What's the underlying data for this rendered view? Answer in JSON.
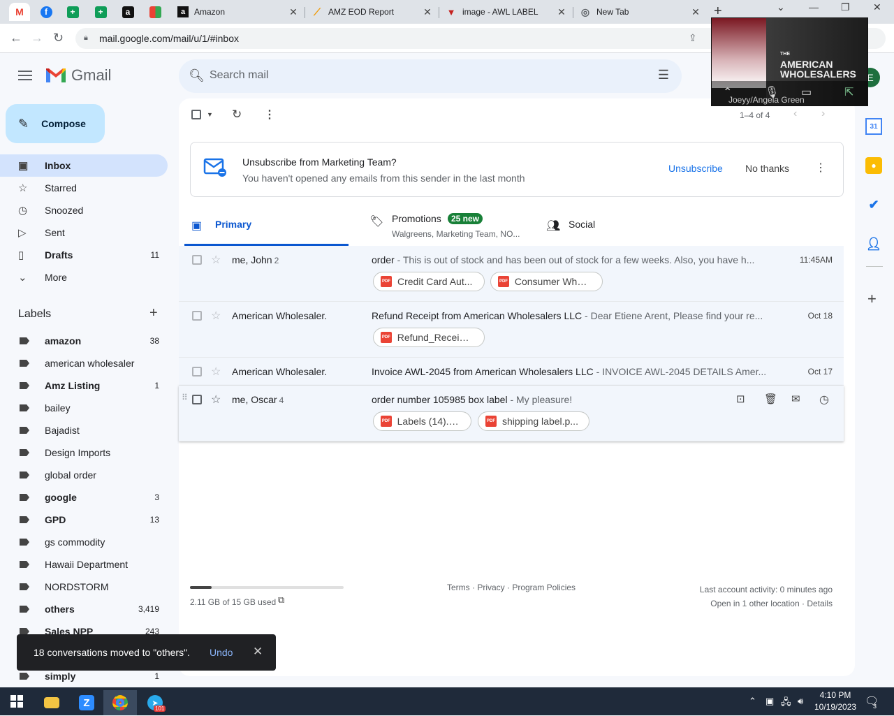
{
  "browser": {
    "tabs": [
      {
        "title": "Amazon"
      },
      {
        "title": "AMZ EOD Report"
      },
      {
        "title": "image - AWL LABEL"
      },
      {
        "title": "New Tab"
      }
    ],
    "url": "mail.google.com/mail/u/1/#inbox"
  },
  "gmail": {
    "brand": "Gmail",
    "search_placeholder": "Search mail",
    "avatar_letter": "E",
    "compose_label": "Compose",
    "nav": [
      {
        "label": "Inbox",
        "icon": "inbox-icon",
        "count": ""
      },
      {
        "label": "Starred",
        "icon": "star-icon",
        "count": ""
      },
      {
        "label": "Snoozed",
        "icon": "clock-icon",
        "count": ""
      },
      {
        "label": "Sent",
        "icon": "send-icon",
        "count": ""
      },
      {
        "label": "Drafts",
        "icon": "draft-icon",
        "count": "11"
      },
      {
        "label": "More",
        "icon": "chevron-down-icon",
        "count": ""
      }
    ],
    "labels_title": "Labels",
    "labels": [
      {
        "name": "amazon",
        "count": "38",
        "bold": true
      },
      {
        "name": "american wholesaler",
        "count": "",
        "bold": false
      },
      {
        "name": "Amz Listing",
        "count": "1",
        "bold": true
      },
      {
        "name": "bailey",
        "count": "",
        "bold": false
      },
      {
        "name": "Bajadist",
        "count": "",
        "bold": false
      },
      {
        "name": "Design Imports",
        "count": "",
        "bold": false
      },
      {
        "name": "global order",
        "count": "",
        "bold": false
      },
      {
        "name": "google",
        "count": "3",
        "bold": true
      },
      {
        "name": "GPD",
        "count": "13",
        "bold": true
      },
      {
        "name": "gs commodity",
        "count": "",
        "bold": false
      },
      {
        "name": "Hawaii Department",
        "count": "",
        "bold": false
      },
      {
        "name": "NORDSTORM",
        "count": "",
        "bold": false
      },
      {
        "name": "others",
        "count": "3,419",
        "bold": true
      },
      {
        "name": "Sales NPP",
        "count": "243",
        "bold": true
      },
      {
        "name": "",
        "count": "",
        "bold": false
      },
      {
        "name": "simply",
        "count": "1",
        "bold": true
      }
    ],
    "pagination": "1–4 of 4",
    "banner": {
      "title": "Unsubscribe from Marketing Team?",
      "subtitle": "You haven't opened any emails from this sender in the last month",
      "unsubscribe": "Unsubscribe",
      "no_thanks": "No thanks"
    },
    "tabs": {
      "primary": "Primary",
      "promotions": "Promotions",
      "promotions_badge": "25 new",
      "promotions_senders": "Walgreens, Marketing Team, NO...",
      "social": "Social"
    },
    "emails": [
      {
        "sender": "me, John",
        "count": "2",
        "subject": "order",
        "snippet": " - This is out of stock and has been out of stock for a few weeks. Also, you have h...",
        "date": "11:45AM",
        "attachments": [
          "Credit Card Aut...",
          "Consumer Whol..."
        ]
      },
      {
        "sender": "American Wholesaler.",
        "count": "",
        "subject": "Refund Receipt from American Wholesalers LLC",
        "snippet": " - Dear Etiene Arent, Please find your re...",
        "date": "Oct 18",
        "attachments": [
          "Refund_Receipt..."
        ]
      },
      {
        "sender": "American Wholesaler.",
        "count": "",
        "subject": "Invoice AWL-2045 from American Wholesalers LLC",
        "snippet": " - INVOICE AWL-2045 DETAILS Amer...",
        "date": "Oct 17",
        "attachments": []
      },
      {
        "sender": "me, Oscar",
        "count": "4",
        "subject": "order number 105985 box label",
        "snippet": " - My pleasure!",
        "date": "",
        "attachments": [
          "Labels (14).pdf",
          "shipping label.p..."
        ]
      }
    ],
    "storage": {
      "text": "2.11 GB of 15 GB used",
      "fraction": 0.14
    },
    "footer_links": "Terms · Privacy · Program Policies",
    "activity": "Last account activity: 0 minutes ago",
    "activity_detail": "Open in 1 other location · Details",
    "toast": {
      "message": "18 conversations moved to \"others\".",
      "undo": "Undo"
    }
  },
  "video": {
    "caption": "Joeyy/Angela Green",
    "title_small": "THE",
    "title_main": "AMERICAN WHOLESALERS"
  },
  "taskbar": {
    "time": "4:10 PM",
    "date": "10/19/2023",
    "telegram_badge": "101",
    "notif_count": "3"
  }
}
